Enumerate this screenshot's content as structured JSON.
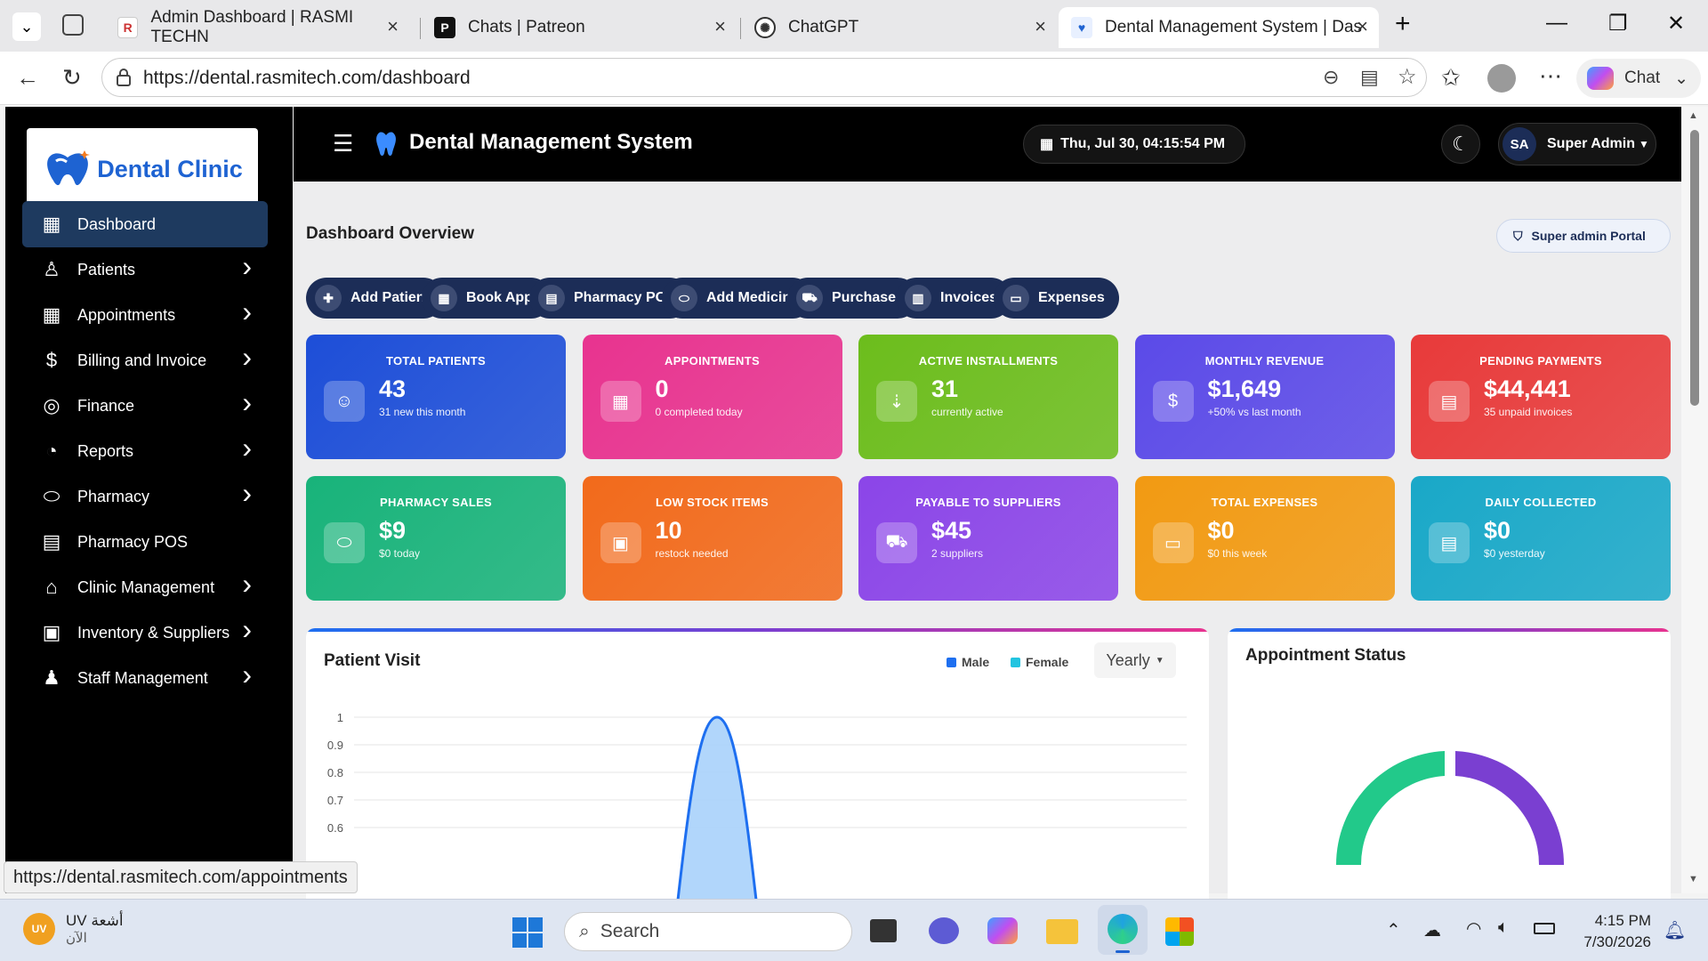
{
  "browser": {
    "tabs": [
      {
        "title": "Admin Dashboard | RASMI TECHN",
        "active": false
      },
      {
        "title": "Chats | Patreon",
        "active": false
      },
      {
        "title": "ChatGPT",
        "active": false
      },
      {
        "title": "Dental Management System | Dasl",
        "active": true
      }
    ],
    "url": "https://dental.rasmitech.com/dashboard",
    "chat_label": "Chat",
    "status_url": "https://dental.rasmitech.com/appointments"
  },
  "sidebar": {
    "logo_text": "Dental Clinic",
    "items": [
      {
        "label": "Dashboard",
        "icon": "dashboard-icon",
        "active": true,
        "chevron": false
      },
      {
        "label": "Patients",
        "icon": "patients-icon",
        "chevron": true
      },
      {
        "label": "Appointments",
        "icon": "calendar-icon",
        "chevron": true
      },
      {
        "label": "Billing and Invoice",
        "icon": "invoice-icon",
        "chevron": true
      },
      {
        "label": "Finance",
        "icon": "coins-icon",
        "chevron": true
      },
      {
        "label": "Reports",
        "icon": "pie-chart-icon",
        "chevron": true
      },
      {
        "label": "Pharmacy",
        "icon": "pills-icon",
        "chevron": true
      },
      {
        "label": "Pharmacy POS",
        "icon": "cash-register-icon",
        "chevron": false
      },
      {
        "label": "Clinic Management",
        "icon": "clinic-icon",
        "chevron": true
      },
      {
        "label": "Inventory & Suppliers",
        "icon": "boxes-icon",
        "chevron": true
      },
      {
        "label": "Staff Management",
        "icon": "staff-icon",
        "chevron": true
      }
    ]
  },
  "header": {
    "title": "Dental Management System",
    "datetime": "Thu, Jul 30, 04:15:54 PM",
    "avatar_initials": "SA",
    "user_name": "Super Admin"
  },
  "main": {
    "page_title": "Dashboard Overview",
    "portal_badge": "Super admin Portal",
    "quick_actions": [
      "Add Patient",
      "Book Appt",
      "Pharmacy POS",
      "Add Medicine",
      "Purchases",
      "Invoices",
      "Expenses"
    ],
    "cards": [
      {
        "title": "TOTAL PATIENTS",
        "value": "43",
        "sub": "31 new this month",
        "color": "#1d4ed8"
      },
      {
        "title": "APPOINTMENTS",
        "value": "0",
        "sub": "0 completed today",
        "color": "#e8338f"
      },
      {
        "title": "ACTIVE INSTALLMENTS",
        "value": "31",
        "sub": "currently active",
        "color": "#6cbd1c"
      },
      {
        "title": "MONTHLY REVENUE",
        "value": "$1,649",
        "sub": "+50% vs last month",
        "color": "#5b4ae8"
      },
      {
        "title": "PENDING PAYMENTS",
        "value": "$44,441",
        "sub": "35 unpaid invoices",
        "color": "#e83a3a"
      },
      {
        "title": "PHARMACY SALES",
        "value": "$9",
        "sub": "$0 today",
        "color": "#18b37a"
      },
      {
        "title": "LOW STOCK ITEMS",
        "value": "10",
        "sub": "restock needed",
        "color": "#f26a1b"
      },
      {
        "title": "PAYABLE TO SUPPLIERS",
        "value": "$45",
        "sub": "2 suppliers",
        "color": "#8b45e8"
      },
      {
        "title": "TOTAL EXPENSES",
        "value": "$0",
        "sub": "$0 this week",
        "color": "#f29a12"
      },
      {
        "title": "DAILY COLLECTED",
        "value": "$0",
        "sub": "$0 yesterday",
        "color": "#19a8c8"
      }
    ],
    "patient_visit": {
      "title": "Patient Visit",
      "legend_male": "Male",
      "legend_female": "Female",
      "period": "Yearly",
      "male_color": "#1e6ff0",
      "female_color": "#22c4e0"
    },
    "appointment_status": {
      "title": "Appointment Status",
      "colors": [
        "#22c98a",
        "#7a3fd1"
      ]
    }
  },
  "chart_data": {
    "type": "area",
    "title": "Patient Visit",
    "y_ticks": [
      "1",
      "0.9",
      "0.8",
      "0.7",
      "0.6"
    ],
    "ylim": [
      0,
      1
    ],
    "series": [
      {
        "name": "Male",
        "peak": 1
      }
    ],
    "legend": "top-right"
  },
  "taskbar": {
    "weather_label": "UV أشعة",
    "weather_sub": "الآن",
    "search_placeholder": "Search",
    "time": "4:15 PM",
    "date": "7/30/2026"
  }
}
